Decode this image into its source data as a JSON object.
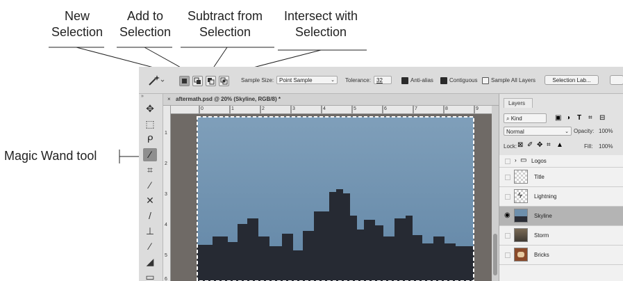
{
  "callouts": {
    "new_selection": {
      "line1": "New",
      "line2": "Selection"
    },
    "add_to_selection": {
      "line1": "Add to",
      "line2": "Selection"
    },
    "subtract_from_selection": {
      "line1": "Subtract from",
      "line2": "Selection"
    },
    "intersect_with_selection": {
      "line1": "Intersect with",
      "line2": "Selection"
    },
    "magic_wand_tool": "Magic Wand tool"
  },
  "options_bar": {
    "sample_size_label": "Sample Size:",
    "sample_size_value": "Point Sample",
    "tolerance_label": "Tolerance:",
    "tolerance_value": "32",
    "anti_alias_label": "Anti-alias",
    "anti_alias_checked": true,
    "contiguous_label": "Contiguous",
    "contiguous_checked": true,
    "sample_all_layers_label": "Sample All Layers",
    "sample_all_layers_checked": false,
    "select_and_mask_button": "Selection Lab..."
  },
  "document": {
    "tab_title": "aftermath.psd @ 20% (Skyline, RGB/8) *",
    "close_glyph": "×",
    "ruler_h": [
      "0",
      "1",
      "2",
      "3",
      "4",
      "5",
      "6",
      "7",
      "8",
      "9"
    ],
    "ruler_v": [
      "1",
      "2",
      "3",
      "4",
      "5",
      "6"
    ]
  },
  "layers_panel": {
    "tab_label": "Layers",
    "filter_kind": "Kind",
    "blend_mode": "Normal",
    "opacity_label": "Opacity:",
    "opacity_value": "100%",
    "lock_label": "Lock:",
    "fill_label": "Fill:",
    "fill_value": "100%",
    "layers": [
      {
        "name": "Logos",
        "type": "group",
        "visible": false,
        "selected": false
      },
      {
        "name": "Title",
        "type": "layer",
        "visible": false,
        "selected": false
      },
      {
        "name": "Lightning",
        "type": "layer",
        "visible": false,
        "selected": false
      },
      {
        "name": "Skyline",
        "type": "layer",
        "visible": true,
        "selected": true
      },
      {
        "name": "Storm",
        "type": "layer",
        "visible": false,
        "selected": false
      },
      {
        "name": "Bricks",
        "type": "layer",
        "visible": false,
        "selected": false
      }
    ]
  },
  "colors": {
    "sky": "#6b8eaa",
    "skyline": "#262a33",
    "canvas_bg": "#6f6a66",
    "panel_bg": "#dcdcdc",
    "selected_layer": "#b4b4b4"
  },
  "tools": [
    "move-tool",
    "marquee-tool",
    "lasso-tool",
    "magic-wand-tool",
    "crop-tool",
    "eyedropper-tool",
    "healing-brush-tool",
    "brush-tool",
    "clone-stamp-tool",
    "history-brush-tool",
    "eraser-tool",
    "gradient-tool",
    "blur-tool"
  ]
}
